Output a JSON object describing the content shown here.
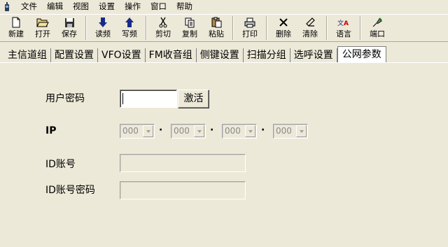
{
  "menu": [
    "文件",
    "编辑",
    "视图",
    "设置",
    "操作",
    "窗口",
    "帮助"
  ],
  "toolbar": [
    {
      "label": "新建",
      "icon": "new-file-icon"
    },
    {
      "label": "打开",
      "icon": "open-folder-icon"
    },
    {
      "label": "保存",
      "icon": "save-disk-icon"
    },
    {
      "label": "读频",
      "icon": "arrow-down-icon"
    },
    {
      "label": "写频",
      "icon": "arrow-up-icon"
    },
    {
      "label": "剪切",
      "icon": "scissors-icon"
    },
    {
      "label": "复制",
      "icon": "copy-icon"
    },
    {
      "label": "粘贴",
      "icon": "paste-icon"
    },
    {
      "label": "打印",
      "icon": "printer-icon"
    },
    {
      "label": "删除",
      "icon": "delete-x-icon"
    },
    {
      "label": "清除",
      "icon": "eraser-icon"
    },
    {
      "label": "语言",
      "icon": "language-icon"
    },
    {
      "label": "端口",
      "icon": "port-icon"
    }
  ],
  "tabs": [
    "主信道组",
    "配置设置",
    "VFO设置",
    "FM收音组",
    "侧键设置",
    "扫描分组",
    "选呼设置",
    "公网参数"
  ],
  "active_tab": "公网参数",
  "form": {
    "password_label": "用户密码",
    "password_value": "",
    "activate_button": "激活",
    "ip_label": "IP",
    "ip_octets": [
      "000",
      "000",
      "000",
      "000"
    ],
    "ip_separator": "·",
    "id_account_label": "ID账号",
    "id_account_value": "",
    "id_password_label": "ID账号密码",
    "id_password_value": ""
  }
}
